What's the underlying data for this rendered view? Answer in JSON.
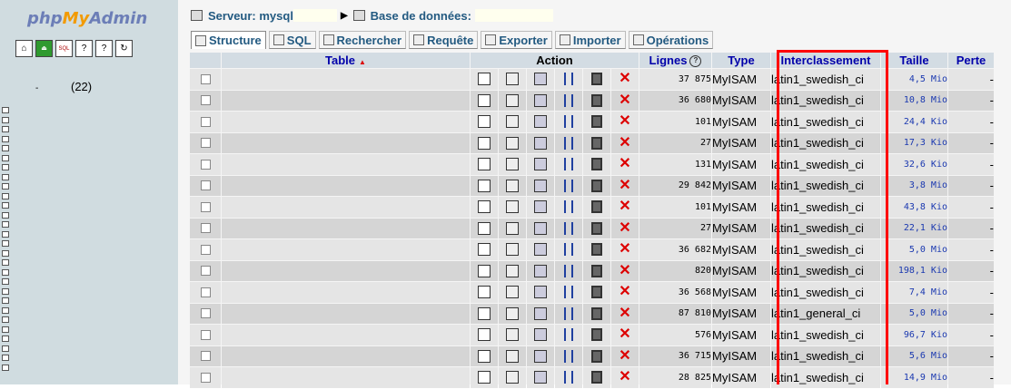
{
  "logo": {
    "php": "php",
    "my": "My",
    "admin": "Admin"
  },
  "left": {
    "db_count": "(22)",
    "dash": "-",
    "table_icon_count": 28
  },
  "breadcrumb": {
    "server_label": "Serveur: mysql",
    "db_label": "Base de données:"
  },
  "tabs": [
    {
      "label": "Structure",
      "icon": "structure-icon",
      "active": true
    },
    {
      "label": "SQL",
      "icon": "sql-icon",
      "active": false
    },
    {
      "label": "Rechercher",
      "icon": "search-icon",
      "active": false
    },
    {
      "label": "Requête",
      "icon": "query-icon",
      "active": false
    },
    {
      "label": "Exporter",
      "icon": "export-icon",
      "active": false
    },
    {
      "label": "Importer",
      "icon": "import-icon",
      "active": false
    },
    {
      "label": "Opérations",
      "icon": "operations-icon",
      "active": false
    }
  ],
  "headers": {
    "table": "Table",
    "action": "Action",
    "rows": "Lignes",
    "type": "Type",
    "collation": "Interclassement",
    "size": "Taille",
    "overhead": "Perte"
  },
  "rows": [
    {
      "rows": "37 875",
      "type": "MyISAM",
      "collation": "latin1_swedish_ci",
      "size": "4,5 Mio",
      "overhead": "-"
    },
    {
      "rows": "36 680",
      "type": "MyISAM",
      "collation": "latin1_swedish_ci",
      "size": "10,8 Mio",
      "overhead": "-"
    },
    {
      "rows": "101",
      "type": "MyISAM",
      "collation": "latin1_swedish_ci",
      "size": "24,4 Kio",
      "overhead": "-"
    },
    {
      "rows": "27",
      "type": "MyISAM",
      "collation": "latin1_swedish_ci",
      "size": "17,3 Kio",
      "overhead": "-"
    },
    {
      "rows": "131",
      "type": "MyISAM",
      "collation": "latin1_swedish_ci",
      "size": "32,6 Kio",
      "overhead": "-"
    },
    {
      "rows": "29 842",
      "type": "MyISAM",
      "collation": "latin1_swedish_ci",
      "size": "3,8 Mio",
      "overhead": "-"
    },
    {
      "rows": "101",
      "type": "MyISAM",
      "collation": "latin1_swedish_ci",
      "size": "43,8 Kio",
      "overhead": "-"
    },
    {
      "rows": "27",
      "type": "MyISAM",
      "collation": "latin1_swedish_ci",
      "size": "22,1 Kio",
      "overhead": "-"
    },
    {
      "rows": "36 682",
      "type": "MyISAM",
      "collation": "latin1_swedish_ci",
      "size": "5,0 Mio",
      "overhead": "-"
    },
    {
      "rows": "820",
      "type": "MyISAM",
      "collation": "latin1_swedish_ci",
      "size": "198,1 Kio",
      "overhead": "-"
    },
    {
      "rows": "36 568",
      "type": "MyISAM",
      "collation": "latin1_swedish_ci",
      "size": "7,4 Mio",
      "overhead": "-"
    },
    {
      "rows": "87 810",
      "type": "MyISAM",
      "collation": "latin1_general_ci",
      "size": "5,0 Mio",
      "overhead": "-"
    },
    {
      "rows": "576",
      "type": "MyISAM",
      "collation": "latin1_swedish_ci",
      "size": "96,7 Kio",
      "overhead": "-"
    },
    {
      "rows": "36 715",
      "type": "MyISAM",
      "collation": "latin1_swedish_ci",
      "size": "5,6 Mio",
      "overhead": "-"
    },
    {
      "rows": "28 825",
      "type": "MyISAM",
      "collation": "latin1_swedish_ci",
      "size": "14,9 Mio",
      "overhead": "-"
    }
  ]
}
